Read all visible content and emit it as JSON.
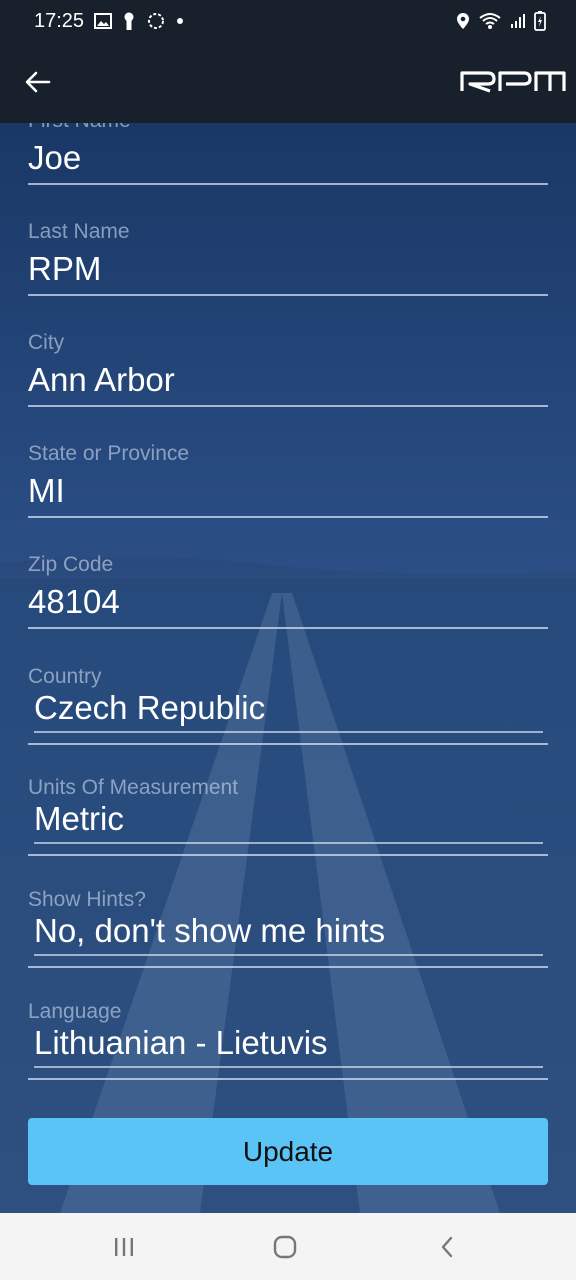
{
  "status_bar": {
    "time": "17:25",
    "left_icons": [
      "image-icon",
      "keyhole-icon",
      "sync-icon",
      "dot-icon"
    ],
    "right_icons": [
      "location-icon",
      "wifi-icon",
      "signal-icon",
      "battery-icon"
    ]
  },
  "app_bar": {
    "back_icon": "arrow-left-icon",
    "logo": "RPM"
  },
  "form": {
    "first_name": {
      "label": "First Name",
      "value": "Joe"
    },
    "last_name": {
      "label": "Last Name",
      "value": "RPM"
    },
    "city": {
      "label": "City",
      "value": "Ann Arbor"
    },
    "state": {
      "label": "State or Province",
      "value": "MI"
    },
    "zip": {
      "label": "Zip Code",
      "value": "48104"
    },
    "country": {
      "label": "Country",
      "value": "Czech Republic"
    },
    "units": {
      "label": "Units Of Measurement",
      "value": "Metric"
    },
    "hints": {
      "label": "Show Hints?",
      "value": "No, don't show me hints"
    },
    "language": {
      "label": "Language",
      "value": "Lithuanian - Lietuvis"
    }
  },
  "update_button": "Update",
  "colors": {
    "bar_background": "#18202b",
    "button": "#5bc4f7",
    "content_background": "#1f4078"
  },
  "nav_bar": {
    "recent_icon": "recent-apps-icon",
    "home_icon": "home-icon",
    "back_icon": "nav-back-icon"
  }
}
